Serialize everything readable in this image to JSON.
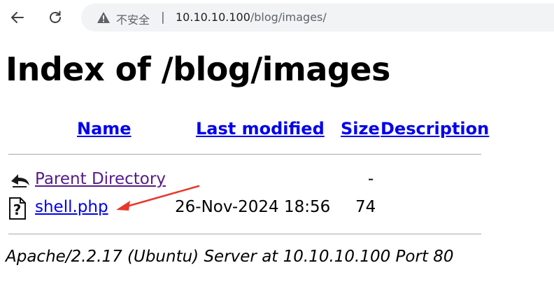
{
  "browser": {
    "security_label": "不安全",
    "separator": "|",
    "url_host": "10.10.10.100",
    "url_path": "/blog/images/"
  },
  "page": {
    "title": "Index of /blog/images",
    "columns": {
      "name": "Name",
      "last_modified": "Last modified",
      "size": "Size",
      "description": "Description"
    },
    "rows": [
      {
        "name": "Parent Directory",
        "modified": "",
        "size": "-",
        "icon": "back-icon"
      },
      {
        "name": "shell.php",
        "modified": "26-Nov-2024 18:56",
        "size": "74",
        "icon": "unknown-file-icon"
      }
    ],
    "server_signature": "Apache/2.2.17 (Ubuntu) Server at 10.10.10.100 Port 80"
  },
  "colors": {
    "link": "#0000ee",
    "visited_link": "#551a8b",
    "annotation_arrow": "#e8372c"
  }
}
